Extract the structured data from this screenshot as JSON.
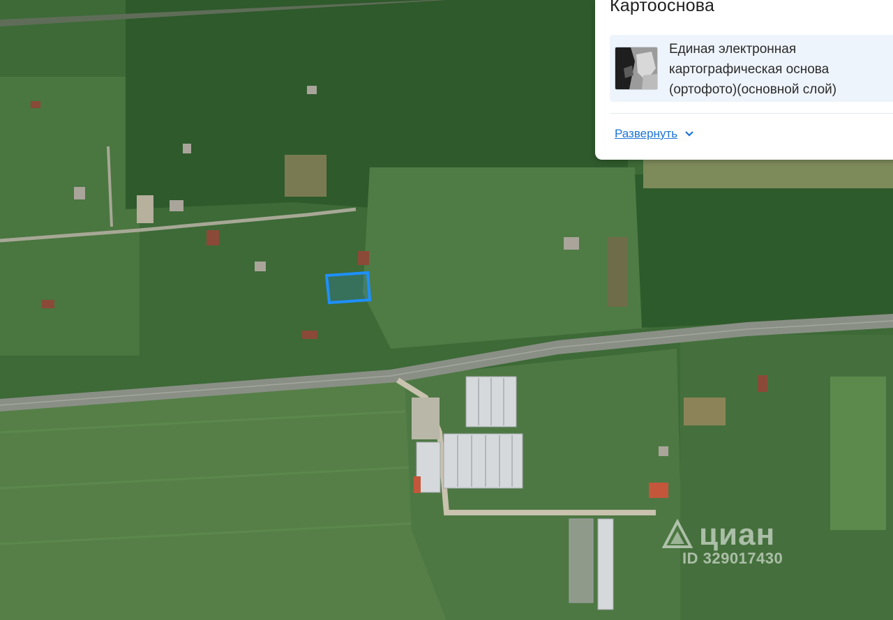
{
  "panel": {
    "title": "Картооснова",
    "layer": {
      "name": "Единая электронная картографическая основа (ортофото)(основной слой)",
      "thumbnail_icon": "orthophoto-thumbnail"
    },
    "expand_label": "Развернуть",
    "expand_icon": "chevron-down-icon"
  },
  "watermark": {
    "brand": "циан",
    "id_text": "ID 329017430"
  },
  "map": {
    "base": "satellite-orthophoto",
    "highlight_color": "#1e90ff",
    "road_color": "#8a8f86"
  }
}
